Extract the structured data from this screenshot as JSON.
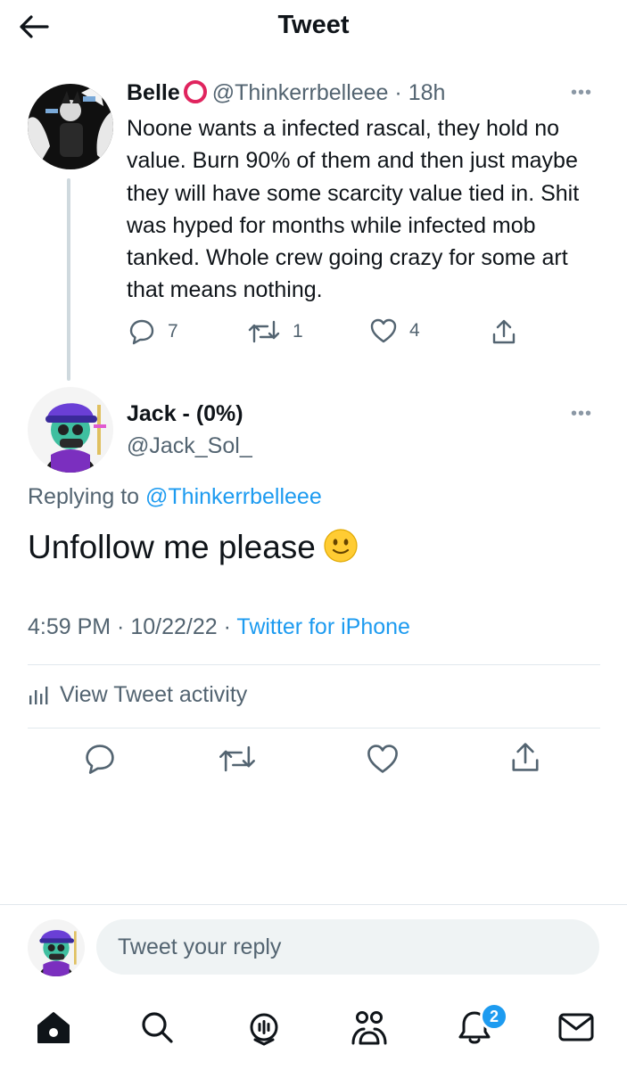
{
  "header": {
    "title": "Tweet"
  },
  "parent_tweet": {
    "name": "Belle",
    "handle": "@Thinkerrbelleee",
    "time": "18h",
    "text": "Noone wants a infected rascal, they hold no value. Burn 90% of them and then just maybe they will have some scarcity value tied in. Shit was hyped for months while infected mob tanked. Whole crew going crazy for some art that means nothing.",
    "replies": "7",
    "retweets": "1",
    "likes": "4"
  },
  "main_tweet": {
    "name": "Jack - (0%)",
    "handle": "@Jack_Sol_",
    "replying_prefix": "Replying to",
    "replying_to": "@Thinkerrbelleee",
    "text": "Unfollow me please",
    "time": "4:59 PM",
    "date": "10/22/22",
    "source": "Twitter for iPhone",
    "activity_label": "View Tweet activity"
  },
  "reply_box": {
    "placeholder": "Tweet your reply"
  },
  "tabbar": {
    "notifications_count": "2"
  },
  "icons": {
    "back": "arrow-left-icon",
    "more": "more-horizontal-icon",
    "reply": "speech-bubble-icon",
    "retweet": "retweet-icon",
    "like": "heart-icon",
    "share": "share-icon",
    "activity": "bar-chart-icon",
    "home": "home-icon",
    "search": "search-icon",
    "spaces": "spaces-icon",
    "communities": "communities-icon",
    "notifications": "bell-icon",
    "messages": "envelope-icon"
  },
  "colors": {
    "accent": "#1d9bf0",
    "text": "#0f1419",
    "muted": "#536471",
    "divider": "#e1e8ed",
    "badge_ring": "#e0245e"
  }
}
